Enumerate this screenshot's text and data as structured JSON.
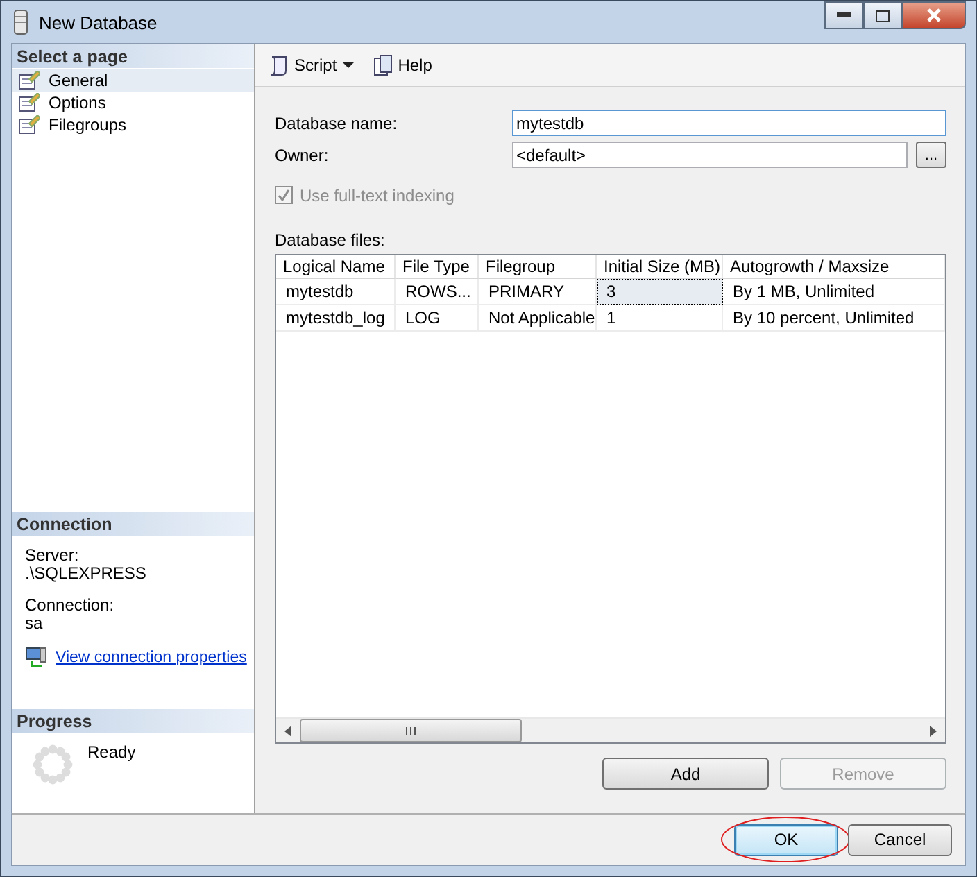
{
  "window": {
    "title": "New Database"
  },
  "sidebar": {
    "header": "Select a page",
    "pages": [
      {
        "label": "General",
        "selected": true
      },
      {
        "label": "Options",
        "selected": false
      },
      {
        "label": "Filegroups",
        "selected": false
      }
    ]
  },
  "connection": {
    "header": "Connection",
    "server_label": "Server:",
    "server": ".\\SQLEXPRESS",
    "connection_label": "Connection:",
    "connection": "sa",
    "link": "View connection properties"
  },
  "progress": {
    "header": "Progress",
    "status": "Ready"
  },
  "toolbar": {
    "script": "Script",
    "help": "Help"
  },
  "form": {
    "name_label": "Database name:",
    "name_value": "mytestdb",
    "owner_label": "Owner:",
    "owner_value": "<default>",
    "browse": "...",
    "fulltext": {
      "label": "Use full-text indexing",
      "checked": true,
      "disabled": true
    },
    "files_label": "Database files:"
  },
  "table": {
    "columns": [
      "Logical Name",
      "File Type",
      "Filegroup",
      "Initial Size (MB)",
      "Autogrowth / Maxsize"
    ],
    "rows": [
      {
        "cells": [
          "mytestdb",
          "ROWS...",
          "PRIMARY",
          "3",
          "By 1 MB, Unlimited"
        ],
        "selected": true
      },
      {
        "cells": [
          "mytestdb_log",
          "LOG",
          "Not Applicable",
          "1",
          "By 10 percent, Unlimited"
        ],
        "selected": false
      }
    ]
  },
  "table_buttons": [
    {
      "label": "Add",
      "disabled": false
    },
    {
      "label": "Remove",
      "disabled": true
    }
  ],
  "dialog_buttons": [
    {
      "label": "OK",
      "default": true,
      "circled": true
    },
    {
      "label": "Cancel",
      "default": false,
      "circled": false
    }
  ]
}
